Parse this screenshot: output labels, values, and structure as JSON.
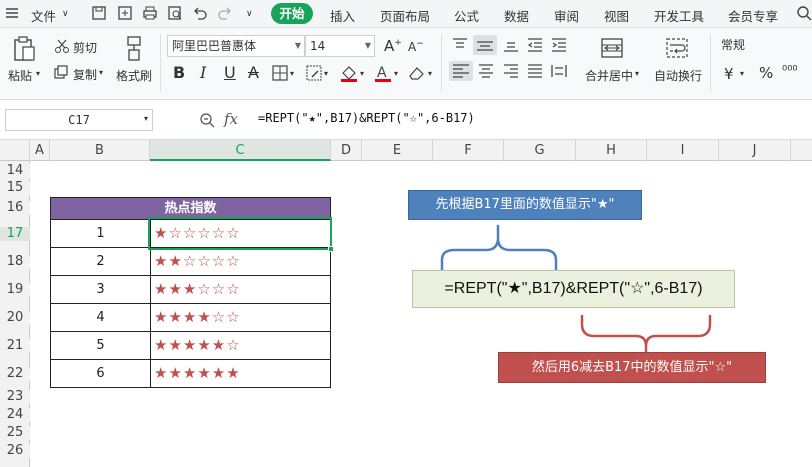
{
  "menubar": {
    "file_label": "文件",
    "tabs": [
      "开始",
      "插入",
      "页面布局",
      "公式",
      "数据",
      "审阅",
      "视图",
      "开发工具",
      "会员专享"
    ]
  },
  "ribbon": {
    "paste_label": "粘贴",
    "cut_label": "剪切",
    "copy_label": "复制",
    "format_painter_label": "格式刷",
    "font_name": "阿里巴巴普惠体",
    "font_size": "14",
    "bold": "B",
    "italic": "I",
    "underline": "U",
    "strike": "A",
    "merge_center_label": "合并居中",
    "wrap_text_label": "自动换行",
    "number_format": "常规"
  },
  "formula_bar": {
    "name_box": "C17",
    "fx": "fx",
    "formula": "=REPT(\"★\",B17)&REPT(\"☆\",6-B17)"
  },
  "columns": [
    "A",
    "B",
    "C",
    "D",
    "E",
    "F",
    "G",
    "H",
    "I",
    "J"
  ],
  "rows": [
    "14",
    "15",
    "16",
    "17",
    "18",
    "19",
    "20",
    "21",
    "22",
    "23",
    "24",
    "25",
    "26"
  ],
  "table": {
    "header": "热点指数",
    "data": [
      {
        "b": "1",
        "stars": "★☆☆☆☆☆"
      },
      {
        "b": "2",
        "stars": "★★☆☆☆☆"
      },
      {
        "b": "3",
        "stars": "★★★☆☆☆"
      },
      {
        "b": "4",
        "stars": "★★★★☆☆"
      },
      {
        "b": "5",
        "stars": "★★★★★☆"
      },
      {
        "b": "6",
        "stars": "★★★★★★"
      }
    ]
  },
  "annotation": {
    "top_callout": "先根据B17里面的数值显示\"★\"",
    "formula_box": "=REPT(\"★\",B17)&REPT(\"☆\",6-B17)",
    "bottom_callout": "然后用6减去B17中的数值显示\"☆\""
  },
  "colors": {
    "accent_green": "#19a35a",
    "header_purple": "#8064a2",
    "callout_blue": "#4f81bd",
    "callout_red": "#c0504d",
    "star_red": "#c0504d",
    "formula_box_bg": "#ebf1de"
  }
}
